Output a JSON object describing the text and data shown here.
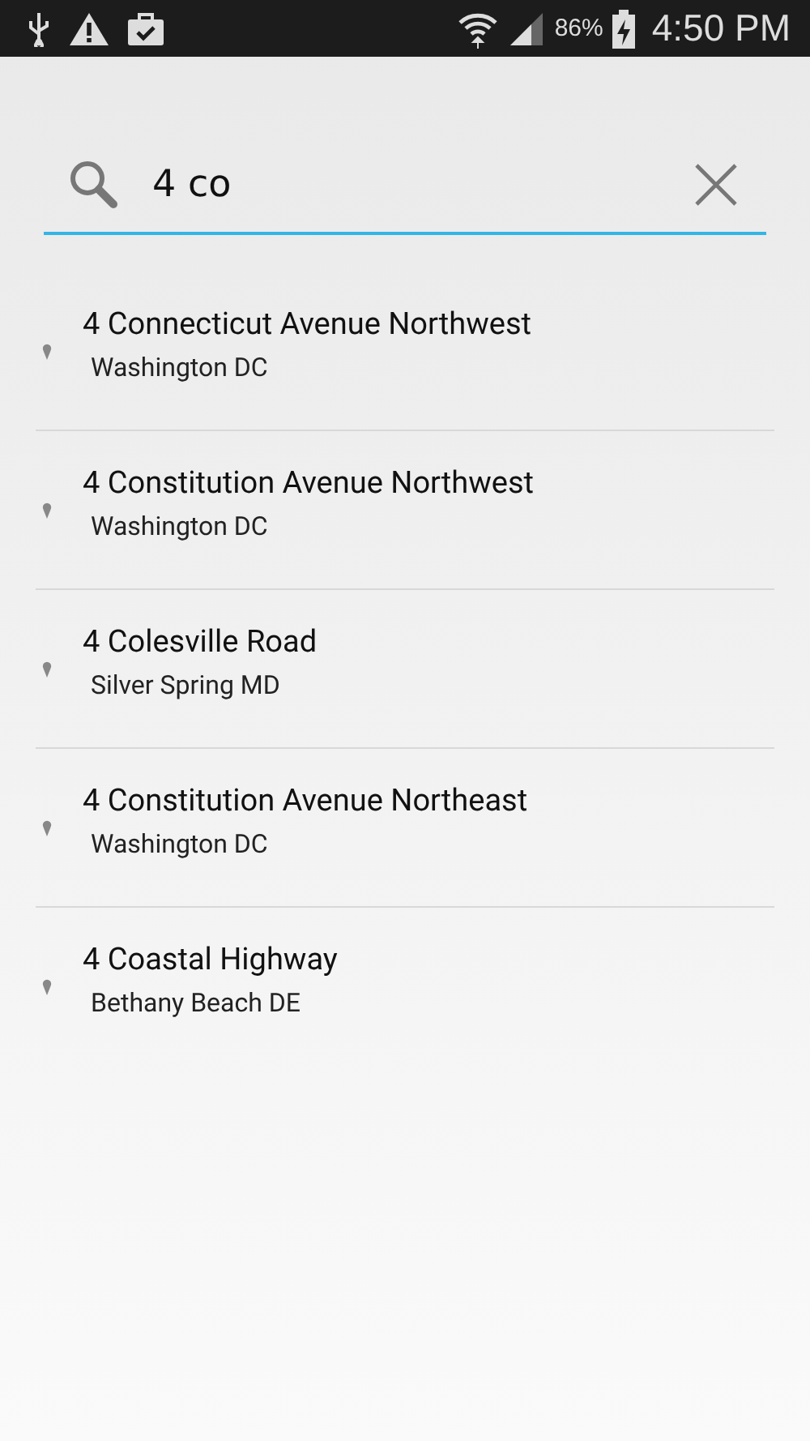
{
  "status_bar": {
    "battery": "86%",
    "time": "4:50 PM"
  },
  "search": {
    "value": "4 co"
  },
  "results": [
    {
      "title": "4 Connecticut Avenue Northwest",
      "subtitle": "Washington DC"
    },
    {
      "title": "4 Constitution Avenue Northwest",
      "subtitle": "Washington DC"
    },
    {
      "title": "4 Colesville Road",
      "subtitle": "Silver Spring MD"
    },
    {
      "title": "4 Constitution Avenue Northeast",
      "subtitle": "Washington DC"
    },
    {
      "title": "4 Coastal Highway",
      "subtitle": "Bethany Beach DE"
    }
  ]
}
